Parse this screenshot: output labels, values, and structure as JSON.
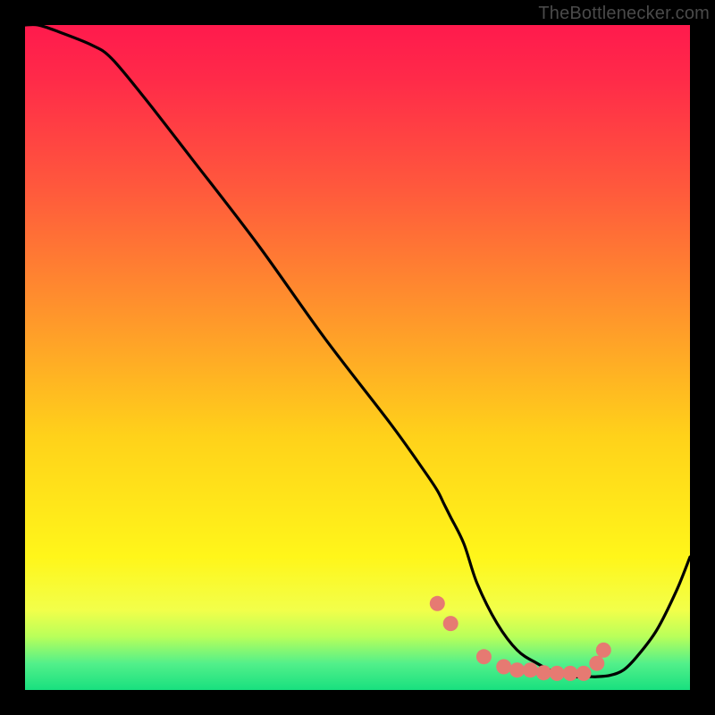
{
  "attribution": "TheBottlenecker.com",
  "chart_data": {
    "type": "line",
    "title": "",
    "xlabel": "",
    "ylabel": "",
    "xlim": [
      0,
      100
    ],
    "ylim": [
      0,
      100
    ],
    "note": "Values read from the curve; x and y are percentage coordinates of the plot area. y=100 is top, y=0 is bottom.",
    "series": [
      {
        "name": "curve",
        "x": [
          0,
          2,
          5,
          10,
          13,
          18,
          25,
          35,
          45,
          55,
          60,
          62,
          63,
          64,
          66,
          68,
          71,
          74,
          77,
          80,
          82,
          84,
          85,
          86,
          88,
          90,
          92,
          95,
          98,
          100
        ],
        "y": [
          100,
          100,
          99,
          97,
          95,
          89,
          80,
          67,
          53,
          40,
          33,
          30,
          28,
          26,
          22,
          16,
          10,
          6,
          4,
          2.5,
          2,
          2,
          2,
          2,
          2.2,
          3,
          5,
          9,
          15,
          20
        ]
      }
    ],
    "markers": {
      "name": "points",
      "color": "#e67a72",
      "x": [
        62,
        64,
        69,
        72,
        74,
        76,
        78,
        80,
        82,
        84,
        86,
        87
      ],
      "y": [
        13,
        10,
        5,
        3.5,
        3,
        3,
        2.6,
        2.5,
        2.5,
        2.5,
        4,
        6
      ]
    }
  }
}
